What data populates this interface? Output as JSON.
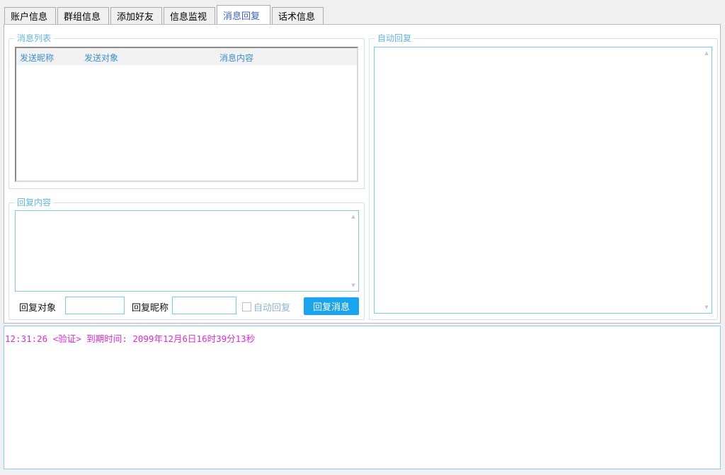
{
  "tabs": [
    {
      "label": "账户信息"
    },
    {
      "label": "群组信息"
    },
    {
      "label": "添加好友"
    },
    {
      "label": "信息监视"
    },
    {
      "label": "消息回复"
    },
    {
      "label": "话术信息"
    }
  ],
  "active_tab": "消息回复",
  "message_list": {
    "legend": "消息列表",
    "columns": [
      "发送昵称",
      "发送对象",
      "消息内容"
    ]
  },
  "reply_content": {
    "legend": "回复内容"
  },
  "reply_target": {
    "label": "回复对象",
    "value": ""
  },
  "reply_nickname": {
    "label": "回复昵称",
    "value": ""
  },
  "auto_reply_checkbox": {
    "label": "自动回复",
    "checked": false
  },
  "reply_button": {
    "label": "回复消息"
  },
  "auto_reply_panel": {
    "legend": "自动回复"
  },
  "log": {
    "lines": [
      "12:31:26 <验证> 到期时间: 2099年12月6日16时39分13秒"
    ]
  },
  "colors": {
    "accent": "#19a4ef",
    "legend": "#5eb6e2",
    "log_text": "#e02bd6",
    "active_tab_text": "#3c5fc9"
  }
}
